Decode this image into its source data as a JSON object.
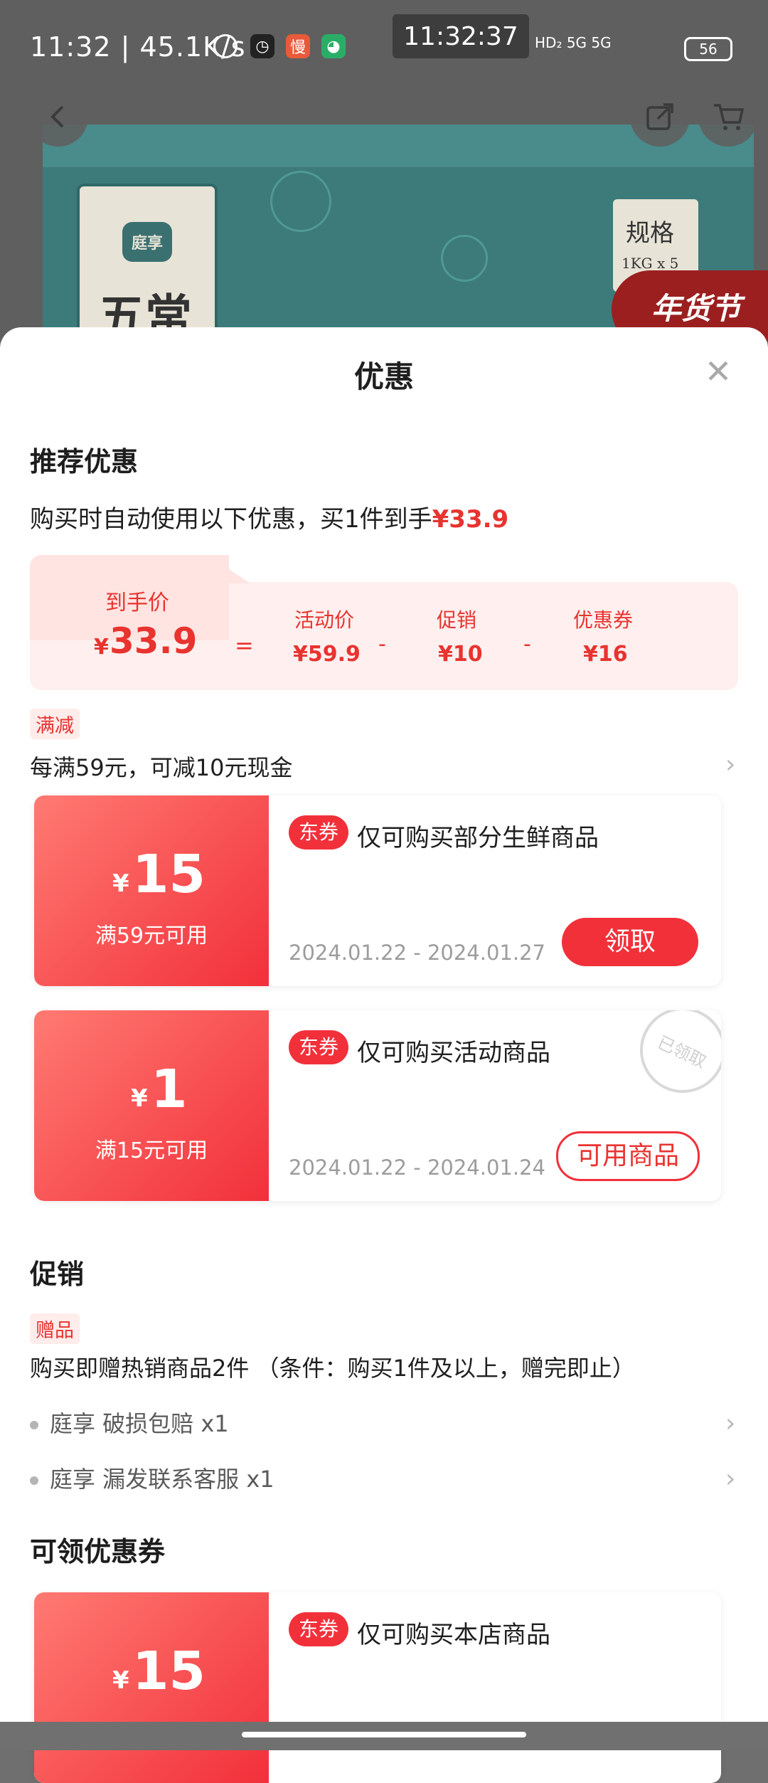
{
  "status_bar": {
    "time_speed": "11:32 | 45.1K/s",
    "clock": "11:32:37",
    "network": "HD₂ 5G 5G",
    "battery": "56"
  },
  "product": {
    "brand": "庭享",
    "name_partial": "五常",
    "spec_title": "规格",
    "spec_sub": "1KG x 5",
    "festival": "年货节"
  },
  "sheet": {
    "title": "优惠",
    "close": "✕"
  },
  "recommend": {
    "title": "推荐优惠",
    "desc_prefix": "购买时自动使用以下优惠，买1件到手",
    "desc_price": "¥33.9",
    "final_label": "到手价",
    "final_sym": "¥",
    "final_value": "33.9",
    "eq": "=",
    "activity_label": "活动价",
    "activity_value": "¥59.9",
    "minus1": "-",
    "promo_label": "促销",
    "promo_value": "¥10",
    "minus2": "-",
    "coupon_label": "优惠券",
    "coupon_value": "¥16"
  },
  "full_reduce": {
    "tag": "满减",
    "text": "每满59元，可减10元现金"
  },
  "coupons": [
    {
      "sym": "¥",
      "amount": "15",
      "condition": "满59元可用",
      "badge": "东券",
      "desc": "仅可购买部分生鲜商品",
      "date": "2024.01.22 - 2024.01.27",
      "button": "领取"
    },
    {
      "sym": "¥",
      "amount": "1",
      "condition": "满15元可用",
      "badge": "东券",
      "desc": "仅可购买活动商品",
      "date": "2024.01.22 - 2024.01.24",
      "button": "可用商品",
      "stamp": "已领取"
    }
  ],
  "promotion": {
    "title": "促销",
    "tag": "赠品",
    "text": "购买即赠热销商品2件 （条件：购买1件及以上，赠完即止）",
    "gifts": [
      "庭享 破损包赔 x1",
      "庭享 漏发联系客服 x1"
    ]
  },
  "claimable": {
    "title": "可领优惠券",
    "coupon": {
      "sym": "¥",
      "amount": "15",
      "badge": "东券",
      "desc": "仅可购买本店商品"
    }
  },
  "icons": {
    "back": "back-arrow-icon",
    "share": "share-icon",
    "cart": "cart-icon",
    "chevron": "chevron-right-icon"
  }
}
